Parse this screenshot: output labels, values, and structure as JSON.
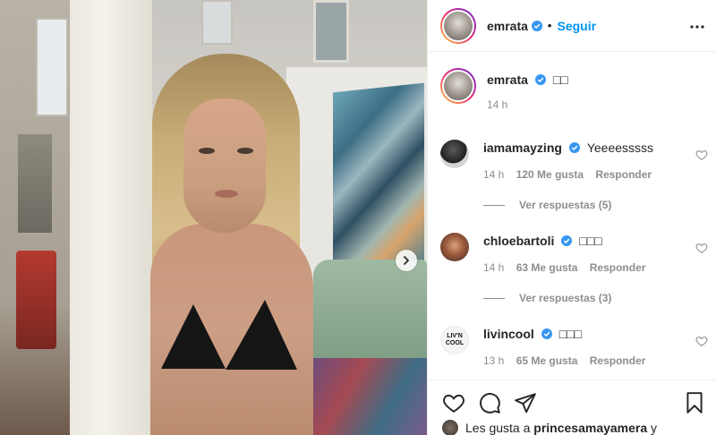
{
  "post": {
    "username": "emrata",
    "follow_label": "Seguir",
    "dot": "•"
  },
  "caption": {
    "username": "emrata",
    "text": "□□",
    "time": "14 h"
  },
  "comments": [
    {
      "username": "iamamayzing",
      "verified": true,
      "text": "Yeeeesssss",
      "time": "14 h",
      "likes": "120 Me gusta",
      "reply": "Responder",
      "view_replies": "Ver respuestas (5)"
    },
    {
      "username": "chloebartoli",
      "verified": true,
      "text": "□□□",
      "time": "14 h",
      "likes": "63 Me gusta",
      "reply": "Responder",
      "view_replies": "Ver respuestas (3)"
    },
    {
      "username": "livincool",
      "verified": true,
      "text": "□□□",
      "time": "13 h",
      "likes": "65 Me gusta",
      "reply": "Responder",
      "avatar_text": "LIV'N COOL"
    }
  ],
  "likes": {
    "prefix": "Les gusta a ",
    "user": "princesamayamera",
    "suffix": " y"
  },
  "colors": {
    "accent": "#0095f6",
    "verified": "#3897f0",
    "meta": "#8e8e8e"
  },
  "icons": [
    "verified-badge-icon",
    "more-options-icon",
    "heart-icon",
    "comment-icon",
    "share-icon",
    "bookmark-icon",
    "chevron-right-icon"
  ]
}
